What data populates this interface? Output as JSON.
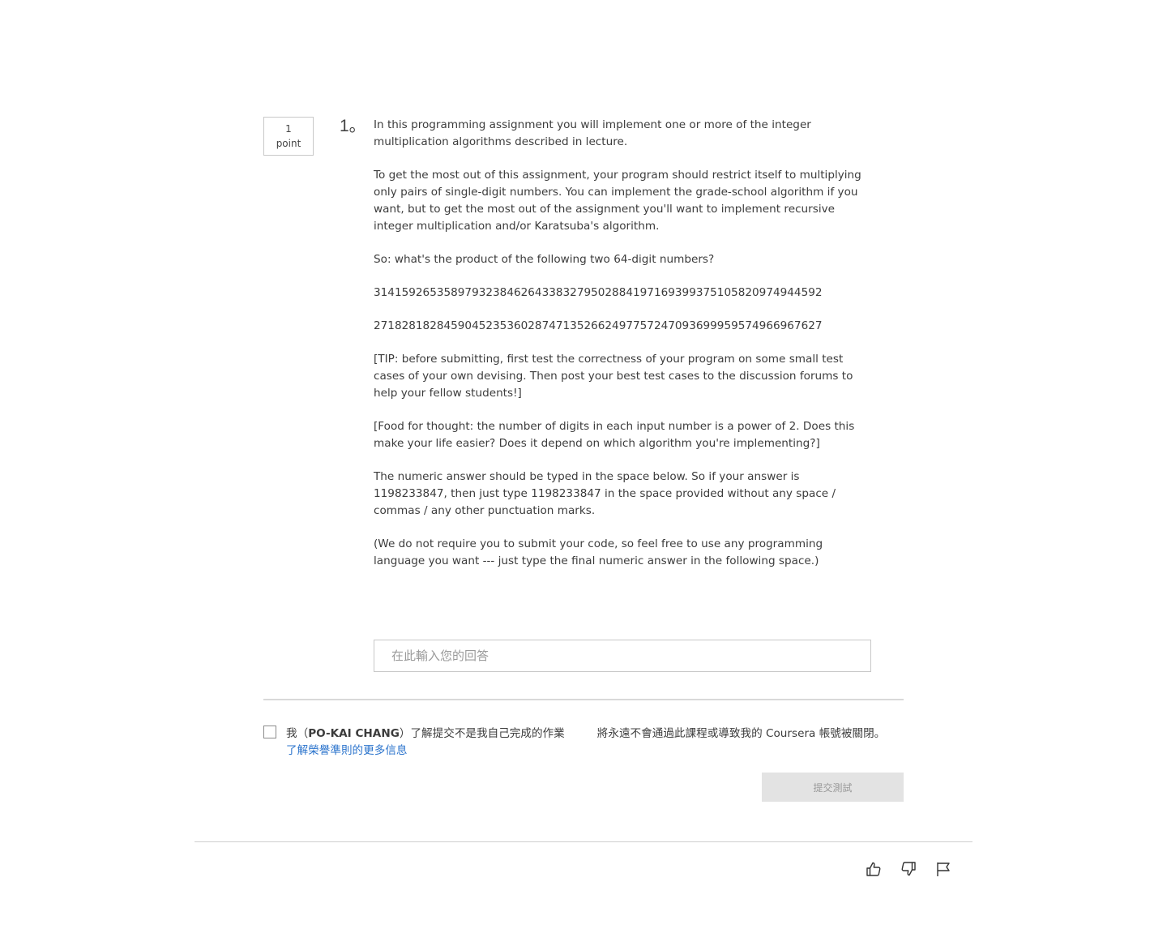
{
  "question": {
    "points_value": "1",
    "points_unit": "point",
    "number": "1。",
    "paragraphs": [
      "In this programming assignment you will implement one or more of the integer multiplication algorithms described in lecture.",
      "To get the most out of this assignment, your program should restrict itself to multiplying only pairs of single-digit numbers. You can implement the grade-school algorithm if you want, but to get the most out of the assignment you'll want to implement recursive integer multiplication and/or Karatsuba's algorithm.",
      "So: what's the product of the following two 64-digit numbers?",
      "3141592653589793238462643383279502884197169399375105820974944592",
      "2718281828459045235360287471352662497757247093699959574966967627",
      "[TIP: before submitting, first test the correctness of your program on some small test cases of your own devising. Then post your best test cases to the discussion forums to help your fellow students!]",
      "[Food for thought: the number of digits in each input number is a power of 2. Does this make your life easier? Does it depend on which algorithm you're implementing?]",
      "The numeric answer should be typed in the space below. So if your answer is 1198233847, then just type 1198233847 in the space provided without any space / commas / any other punctuation marks.",
      "(We do not require you to submit your code, so feel free to use any programming language you want --- just type the final numeric answer in the following space.)"
    ],
    "answer_placeholder": "在此輸入您的回答",
    "answer_value": ""
  },
  "honor_code": {
    "prefix": "我（",
    "name": "PO-KAI CHANG",
    "middle": "）了解提交不是我自己完成的作業",
    "suffix": "將永遠不會通過此課程或導致我的 Coursera 帳號被關閉。",
    "learn_more_link": "了解榮譽準則的更多信息",
    "checked": false
  },
  "submit": {
    "label": "提交測試",
    "enabled": false
  },
  "feedback": {
    "icons": [
      "thumbs-up-icon",
      "thumbs-down-icon",
      "flag-icon"
    ]
  }
}
